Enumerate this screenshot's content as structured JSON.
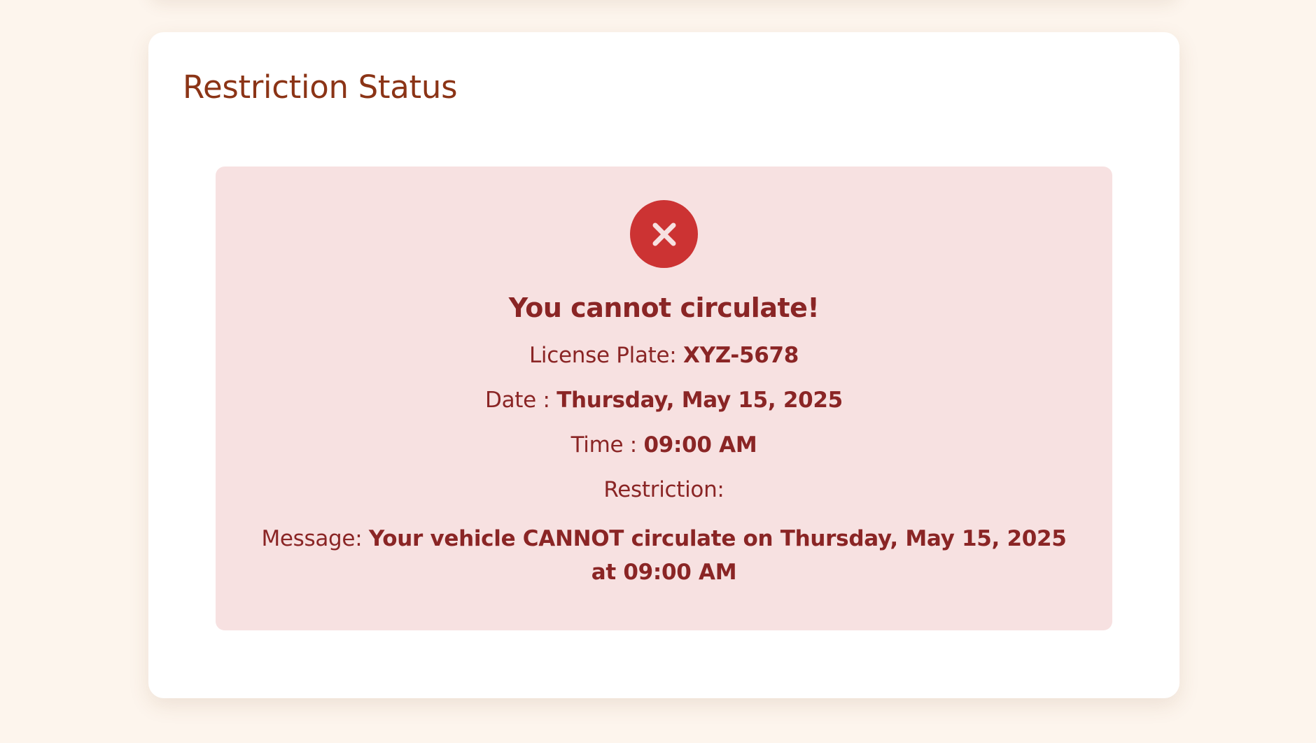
{
  "page": {
    "title": "Restriction Status"
  },
  "result": {
    "status_icon": "close-icon",
    "headline": "You cannot circulate!",
    "license_plate_label": "License Plate: ",
    "license_plate_value": "XYZ-5678",
    "date_label": "Date : ",
    "date_value": "Thursday, May 15, 2025",
    "time_label": "Time : ",
    "time_value": "09:00 AM",
    "restriction_label": "Restriction:",
    "restriction_value": "",
    "message_label": "Message: ",
    "message_value": "Your vehicle CANNOT circulate on Thursday, May 15, 2025 at 09:00 AM"
  },
  "colors": {
    "page_background": "#fdf5ed",
    "card_background": "#ffffff",
    "title_color": "#8b3416",
    "alert_background": "#f7e1e1",
    "alert_text": "#8a2525",
    "icon_background": "#cc3333"
  }
}
